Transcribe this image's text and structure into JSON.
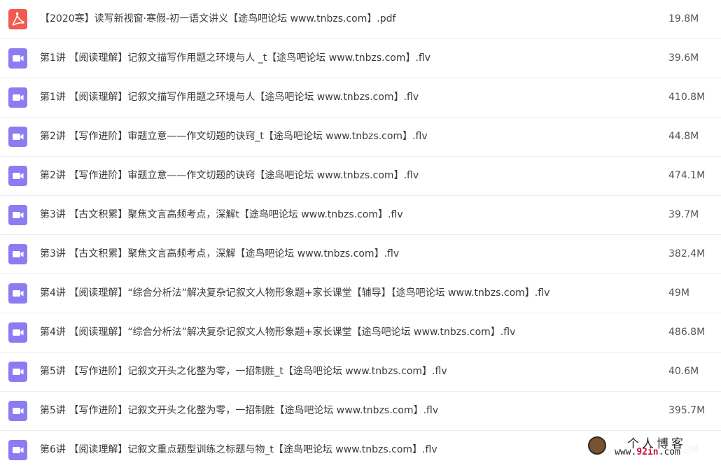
{
  "files": [
    {
      "type": "pdf",
      "icon": "pdf-file-icon",
      "name": "【2020寒】读写新视窗·寒假-初一语文讲义【途鸟吧论坛 www.tnbzs.com】.pdf",
      "size": "19.8M"
    },
    {
      "type": "video",
      "icon": "video-file-icon",
      "name": "第1讲 【阅读理解】记叙文描写作用题之环境与人 _t【途鸟吧论坛 www.tnbzs.com】.flv",
      "size": "39.6M"
    },
    {
      "type": "video",
      "icon": "video-file-icon",
      "name": "第1讲 【阅读理解】记叙文描写作用题之环境与人【途鸟吧论坛 www.tnbzs.com】.flv",
      "size": "410.8M"
    },
    {
      "type": "video",
      "icon": "video-file-icon",
      "name": "第2讲 【写作进阶】审题立意——作文切题的诀窍_t【途鸟吧论坛 www.tnbzs.com】.flv",
      "size": "44.8M"
    },
    {
      "type": "video",
      "icon": "video-file-icon",
      "name": "第2讲 【写作进阶】审题立意——作文切题的诀窍【途鸟吧论坛 www.tnbzs.com】.flv",
      "size": "474.1M"
    },
    {
      "type": "video",
      "icon": "video-file-icon",
      "name": "第3讲 【古文积累】聚焦文言高频考点，深解t【途鸟吧论坛 www.tnbzs.com】.flv",
      "size": "39.7M"
    },
    {
      "type": "video",
      "icon": "video-file-icon",
      "name": "第3讲 【古文积累】聚焦文言高频考点，深解【途鸟吧论坛 www.tnbzs.com】.flv",
      "size": "382.4M"
    },
    {
      "type": "video",
      "icon": "video-file-icon",
      "name": "第4讲 【阅读理解】“综合分析法”解决复杂记叙文人物形象题+家长课堂【辅导】【途鸟吧论坛 www.tnbzs.com】.flv",
      "size": "49M"
    },
    {
      "type": "video",
      "icon": "video-file-icon",
      "name": "第4讲 【阅读理解】“综合分析法”解决复杂记叙文人物形象题+家长课堂【途鸟吧论坛 www.tnbzs.com】.flv",
      "size": "486.8M"
    },
    {
      "type": "video",
      "icon": "video-file-icon",
      "name": "第5讲 【写作进阶】记叙文开头之化整为零，一招制胜_t【途鸟吧论坛 www.tnbzs.com】.flv",
      "size": "40.6M"
    },
    {
      "type": "video",
      "icon": "video-file-icon",
      "name": "第5讲 【写作进阶】记叙文开头之化整为零，一招制胜【途鸟吧论坛 www.tnbzs.com】.flv",
      "size": "395.7M"
    },
    {
      "type": "video",
      "icon": "video-file-icon",
      "name": "第6讲 【阅读理解】记叙文重点题型训练之标题与物_t【途鸟吧论坛 www.tnbzs.com】.flv",
      "size": "40.2M"
    }
  ],
  "watermark": {
    "title": "个人博客",
    "url_prefix": "www.",
    "url_highlight": "92in",
    "url_suffix": ".com"
  },
  "colors": {
    "pdf_icon": "#f25a4f",
    "video_icon": "#8b7cf2",
    "row_divider": "#ececec"
  }
}
